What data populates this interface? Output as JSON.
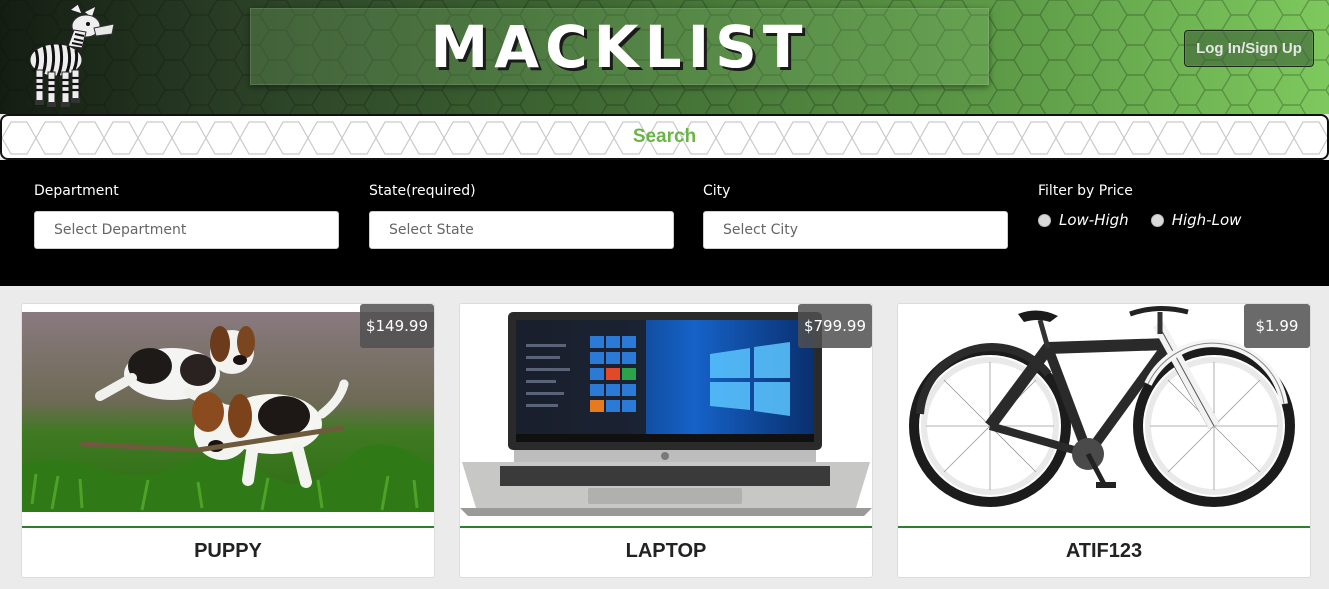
{
  "header": {
    "title": "MACKLIST",
    "login_label": "Log In/Sign Up"
  },
  "search": {
    "label": "Search"
  },
  "filters": {
    "department": {
      "label": "Department",
      "placeholder": "Select Department"
    },
    "state": {
      "label": "State(required)",
      "placeholder": "Select State"
    },
    "city": {
      "label": "City",
      "placeholder": "Select City"
    },
    "price": {
      "label": "Filter by Price",
      "options": [
        "Low-High",
        "High-Low"
      ]
    }
  },
  "listings": [
    {
      "name": "PUPPY",
      "price": "$149.99",
      "image": "puppies-photo"
    },
    {
      "name": "LAPTOP",
      "price": "$799.99",
      "image": "laptop-photo"
    },
    {
      "name": "ATIF123",
      "price": "$1.99",
      "image": "bicycle-photo"
    }
  ],
  "colors": {
    "accent_green": "#6bb447",
    "header_dark": "#141d12",
    "header_light": "#7ec95e",
    "divider_green": "#2e7d32"
  }
}
